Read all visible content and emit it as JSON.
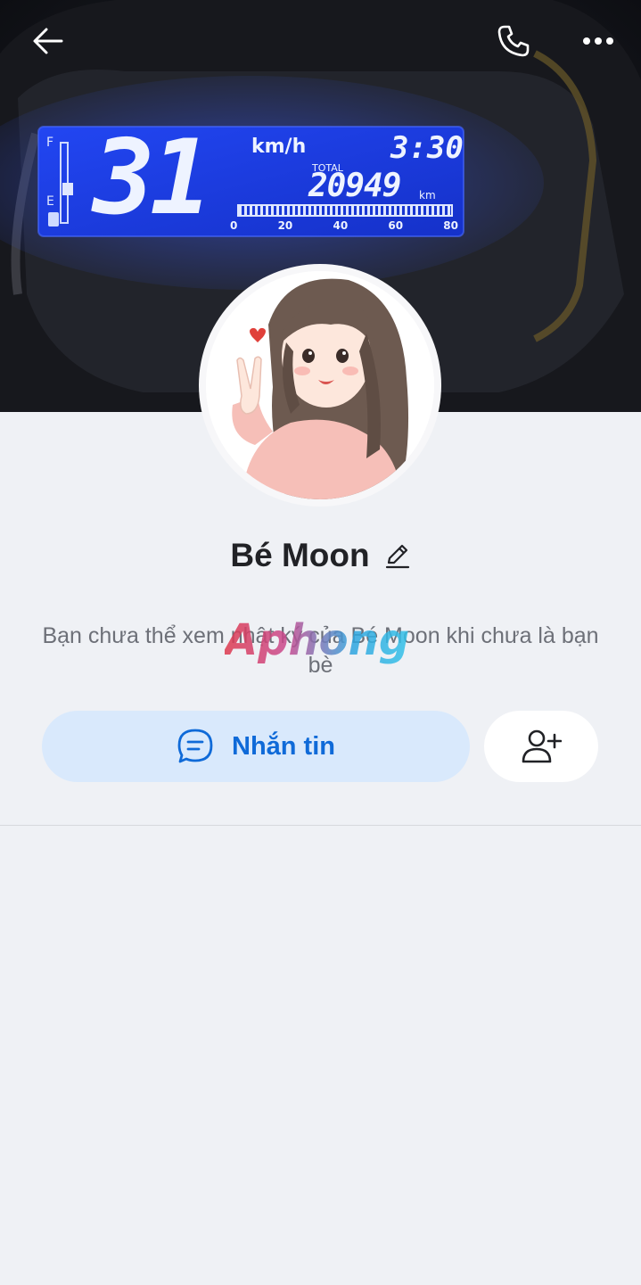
{
  "header": {
    "back_icon": "back-arrow-icon",
    "call_icon": "phone-icon",
    "more_icon": "more-dots-icon"
  },
  "cover": {
    "speed": "31",
    "speed_unit": "km/h",
    "time": "3:30",
    "total_label": "TOTAL",
    "odometer": "20949",
    "odometer_unit": "km",
    "scale": [
      "0",
      "20",
      "40",
      "60",
      "80"
    ]
  },
  "profile": {
    "name": "Bé Moon",
    "edit_icon": "pencil-icon",
    "privacy_note": "Bạn chưa thể xem nhật ký của Bé Moon khi chưa là bạn bè"
  },
  "actions": {
    "message_label": "Nhắn tin",
    "message_icon": "chat-bubble-icon",
    "add_friend_icon": "add-friend-icon"
  },
  "watermark": {
    "text": "Aphong"
  },
  "colors": {
    "accent": "#0f6ad8",
    "message_bg": "#d9e9fc",
    "page_bg": "#eff1f5",
    "lcd_blue": "#1f3ee8"
  }
}
